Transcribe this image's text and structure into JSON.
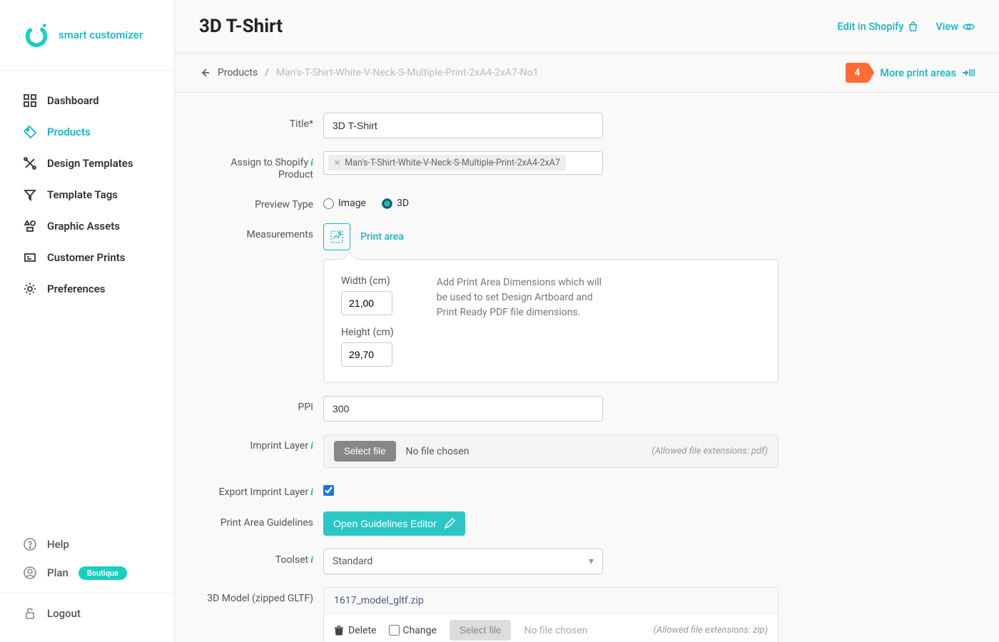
{
  "brand": {
    "name": "smart customizer"
  },
  "sidebar": {
    "items": [
      {
        "label": "Dashboard"
      },
      {
        "label": "Products"
      },
      {
        "label": "Design Templates"
      },
      {
        "label": "Template Tags"
      },
      {
        "label": "Graphic Assets"
      },
      {
        "label": "Customer Prints"
      },
      {
        "label": "Preferences"
      }
    ],
    "bottom": {
      "help": "Help",
      "plan": "Plan",
      "plan_badge": "Boutique",
      "logout": "Logout"
    }
  },
  "header": {
    "title": "3D T-Shirt",
    "edit_shopify": "Edit in Shopify",
    "view": "View"
  },
  "breadcrumb": {
    "root": "Products",
    "sep": "/",
    "current": "Man's-T-Shirt-White-V-Neck-S-Multiple-Print-2xA4-2xA7-No1"
  },
  "print_areas": {
    "count": "4",
    "more": "More print areas"
  },
  "form": {
    "title_label": "Title*",
    "title_value": "3D T-Shirt",
    "assign_label_l1": "Assign to Shopify",
    "assign_label_l2": "Product",
    "assign_chip": "Man's-T-Shirt-White-V-Neck-S-Multiple-Print-2xA4-2xA7",
    "preview_label": "Preview Type",
    "preview_image": "Image",
    "preview_3d": "3D",
    "measurements_label": "Measurements",
    "print_area_tab": "Print area",
    "width_label": "Width (cm)",
    "width_value": "21,00",
    "height_label": "Height (cm)",
    "height_value": "29,70",
    "meas_help": "Add Print Area Dimensions which will be used to set Design Artboard and Print Ready PDF file dimensions.",
    "ppi_label": "PPI",
    "ppi_value": "300",
    "imprint_label": "Imprint Layer",
    "select_file": "Select file",
    "no_file": "No file chosen",
    "allowed_pdf": "(Allowed file extensions: pdf)",
    "export_imprint_label": "Export Imprint Layer",
    "guidelines_label": "Print Area Guidelines",
    "guidelines_button": "Open Guidelines Editor",
    "toolset_label": "Toolset",
    "toolset_value": "Standard",
    "model_label": "3D Model (zipped GLTF)",
    "model_file": "1617_model_gltf.zip",
    "delete": "Delete",
    "change": "Change",
    "allowed_zip": "(Allowed file extensions: zip)"
  }
}
